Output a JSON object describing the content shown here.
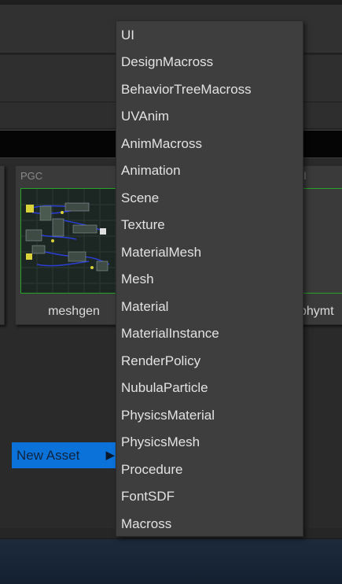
{
  "assets": [
    {
      "type": "",
      "name": ""
    },
    {
      "type": "PGC",
      "name": "meshgen"
    },
    {
      "type": "Mtl",
      "name": "phymt"
    }
  ],
  "context_menu": {
    "new_asset_label": "New Asset",
    "submenu_arrow": "▶"
  },
  "submenu": {
    "items": [
      "UI",
      "DesignMacross",
      "BehaviorTreeMacross",
      "UVAnim",
      "AnimMacross",
      "Animation",
      "Scene",
      "Texture",
      "MaterialMesh",
      "Mesh",
      "Material",
      "MaterialInstance",
      "RenderPolicy",
      "NubulaParticle",
      "PhysicsMaterial",
      "PhysicsMesh",
      "Procedure",
      "FontSDF",
      "Macross"
    ]
  },
  "colors": {
    "highlight": "#0b72d9",
    "thumbnail_border": "#27a327",
    "menu_bg": "#3e3e3e"
  }
}
